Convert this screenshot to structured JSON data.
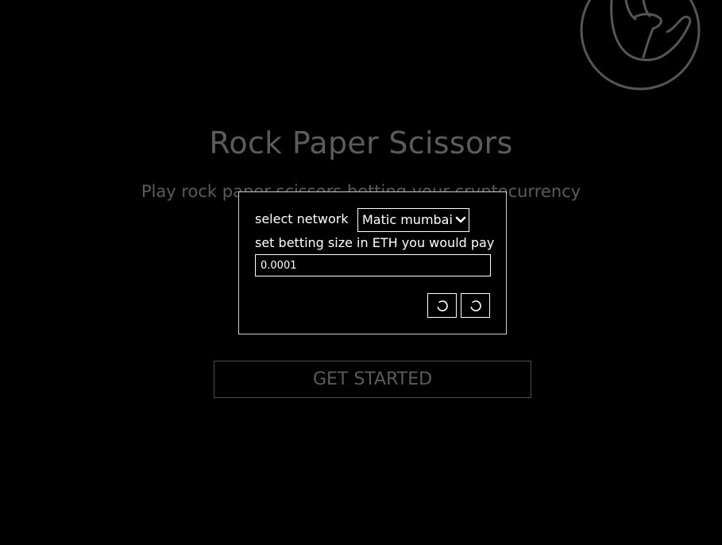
{
  "hero": {
    "title": "Rock Paper Scissors",
    "subtitle": "Play rock paper scissors betting your cryptocurrency"
  },
  "cta": {
    "label": "GET STARTED"
  },
  "modal": {
    "network_label": "select network",
    "network_selected": "Matic mumbai",
    "betting_label": "set betting size in ETH you would pay",
    "betting_value": "0.0001",
    "buttons": [
      {
        "icon": "loading-spinner-icon"
      },
      {
        "icon": "loading-spinner-icon"
      }
    ]
  },
  "logo": {
    "icon": "hand-icon"
  },
  "colors": {
    "background": "#000000",
    "foreground": "#ffffff",
    "muted_text": "#5b5b5b",
    "logo_stroke": "#555555"
  }
}
